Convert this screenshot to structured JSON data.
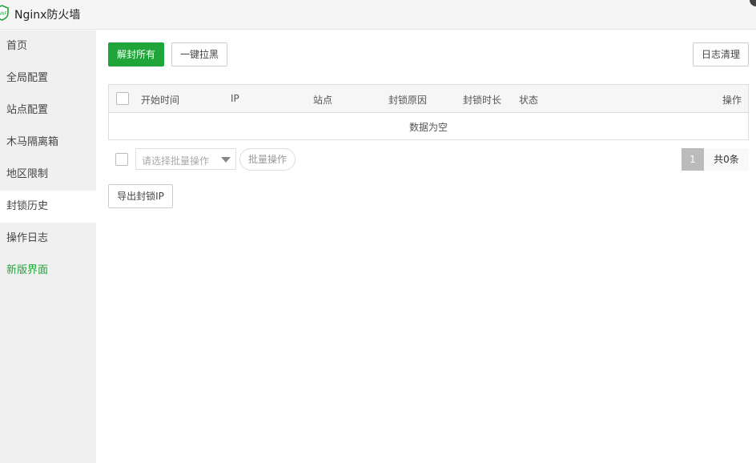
{
  "app": {
    "title": "Nginx防火墙",
    "logo_icon": "waf-shield-icon"
  },
  "sidebar": {
    "items": [
      {
        "label": "首页"
      },
      {
        "label": "全局配置"
      },
      {
        "label": "站点配置"
      },
      {
        "label": "木马隔离箱"
      },
      {
        "label": "地区限制"
      },
      {
        "label": "封锁历史",
        "active": true
      },
      {
        "label": "操作日志"
      },
      {
        "label": "新版界面",
        "color": "#20a53a"
      }
    ]
  },
  "toolbar": {
    "unblock_all": "解封所有",
    "blacklist_one_click": "一键拉黑",
    "clear_logs": "日志清理"
  },
  "table": {
    "columns": [
      "开始时间",
      "IP",
      "站点",
      "封锁原因",
      "封锁时长",
      "状态",
      "操作"
    ],
    "empty_text": "数据为空"
  },
  "batch": {
    "select_placeholder": "请选择批量操作",
    "batch_button": "批量操作"
  },
  "pagination": {
    "current_page": "1",
    "total": "共0条"
  },
  "export": {
    "label": "导出封锁IP"
  },
  "colors": {
    "accent": "#20a53a"
  }
}
